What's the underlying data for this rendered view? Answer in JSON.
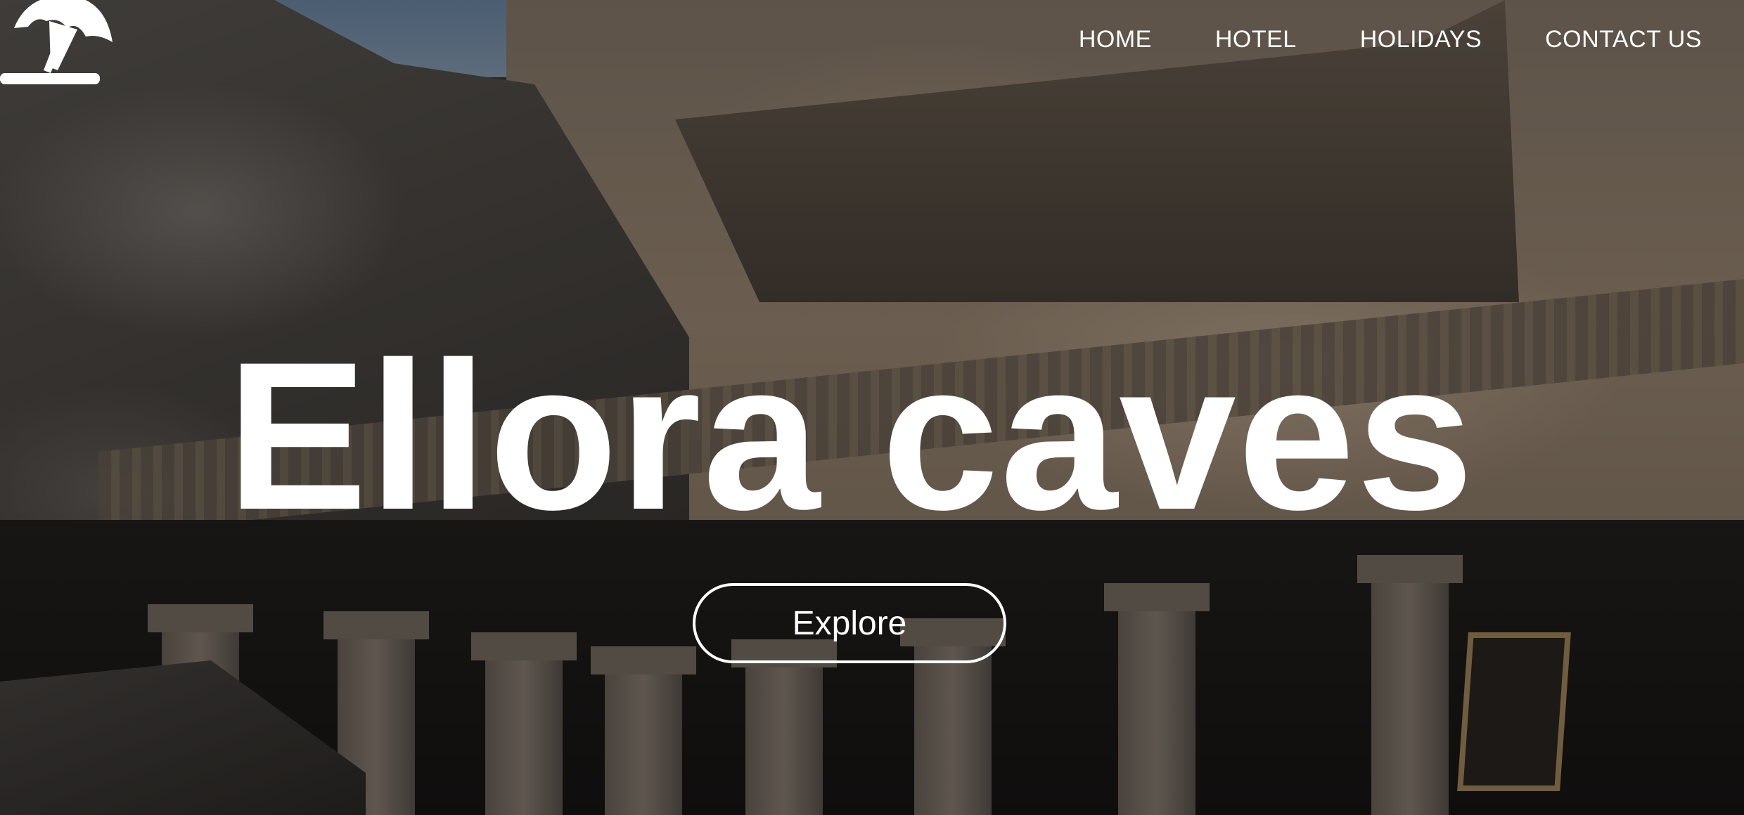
{
  "brand": {
    "logo_icon": "beach-umbrella-icon",
    "color": "#ffffff"
  },
  "nav": {
    "items": [
      {
        "label": "HOME"
      },
      {
        "label": "HOTEL"
      },
      {
        "label": "HOLIDAYS"
      },
      {
        "label": "CONTACT US"
      }
    ]
  },
  "hero": {
    "title": "Ellora caves",
    "button_label": "Explore",
    "background_description_icon": "cave-temple-photo",
    "text_color": "#ffffff"
  }
}
